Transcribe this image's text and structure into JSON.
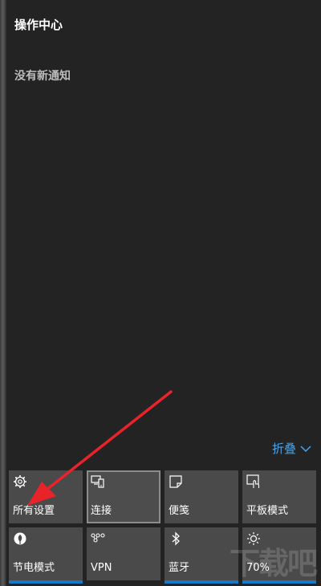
{
  "action_center": {
    "title": "操作中心",
    "empty_message": "没有新通知",
    "collapse_label": "折叠"
  },
  "quick_actions": [
    {
      "label": "所有设置",
      "icon": "gear-icon"
    },
    {
      "label": "连接",
      "icon": "connect-icon",
      "state": "focused"
    },
    {
      "label": "便笺",
      "icon": "note-icon"
    },
    {
      "label": "平板模式",
      "icon": "tablet-mode-icon"
    },
    {
      "label": "节电模式",
      "icon": "battery-saver-icon",
      "state": "on"
    },
    {
      "label": "VPN",
      "icon": "vpn-icon"
    },
    {
      "label": "蓝牙",
      "icon": "bluetooth-icon",
      "state": "on"
    },
    {
      "label": "70%",
      "icon": "brightness-icon",
      "state": "on"
    }
  ],
  "colors": {
    "accent": "#1479c9",
    "link": "#4aa3e8",
    "annotation_arrow": "#e8232a"
  },
  "watermark": "下载吧"
}
